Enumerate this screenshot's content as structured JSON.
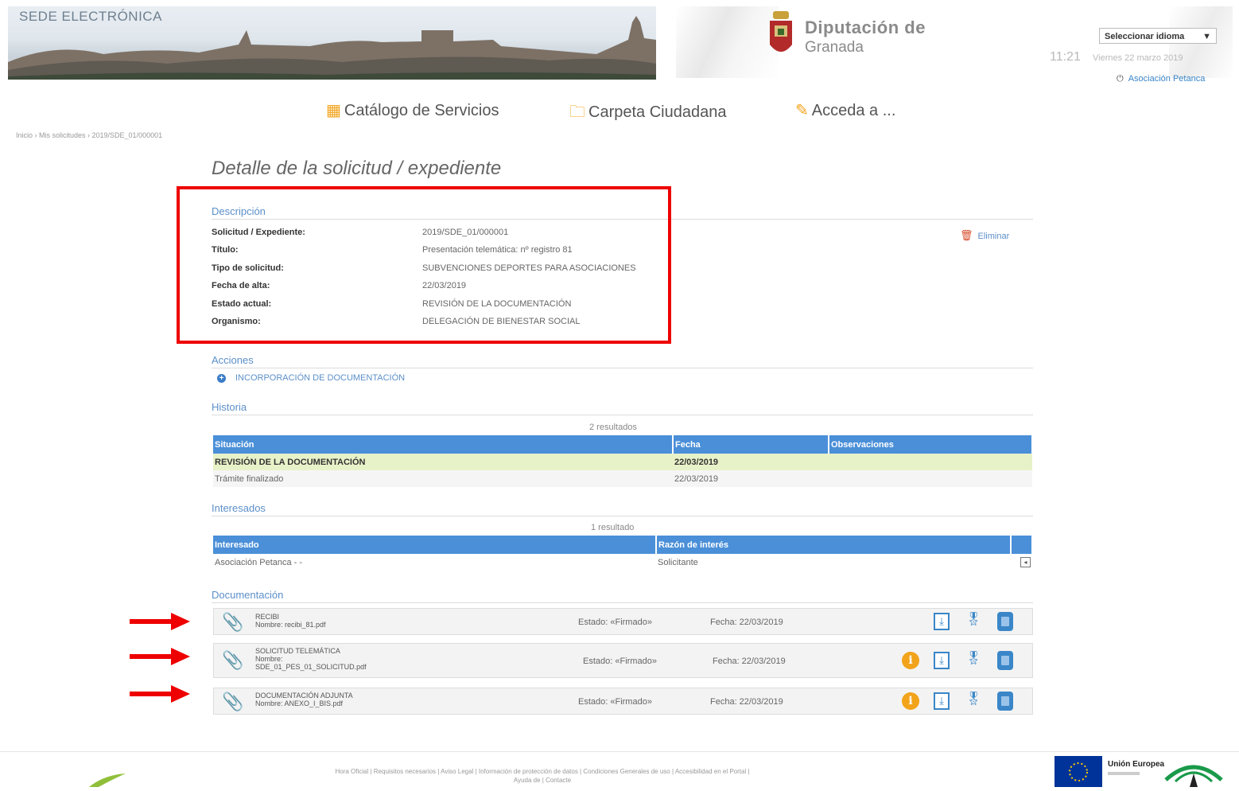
{
  "header": {
    "portal_name": "SEDE ELECTRÓNICA",
    "org_line1": "Diputación de",
    "org_line2": "Granada",
    "language_select": "Seleccionar idioma",
    "time": "11:21",
    "date": "Viernes 22 marzo 2019",
    "user": "Asociación Petanca"
  },
  "nav": [
    {
      "label": "Catálogo de Servicios",
      "icon": "grid-icon"
    },
    {
      "label": "Carpeta Ciudadana",
      "icon": "folder-icon"
    },
    {
      "label": "Acceda a ...",
      "icon": "pencil-icon"
    }
  ],
  "breadcrumb": "Inicio › Mis solicitudes › 2019/SDE_01/000001",
  "page_title": "Detalle de la solicitud / expediente",
  "descripcion": {
    "title": "Descripción",
    "rows": [
      {
        "label": "Solicitud / Expediente:",
        "value": "2019/SDE_01/000001"
      },
      {
        "label": "Título:",
        "value": "Presentación telemática: nº registro 81"
      },
      {
        "label": "Tipo de solicitud:",
        "value": "SUBVENCIONES DEPORTES PARA ASOCIACIONES"
      },
      {
        "label": "Fecha de alta:",
        "value": "22/03/2019"
      },
      {
        "label": "Estado actual:",
        "value": "REVISIÓN DE LA DOCUMENTACIÓN"
      },
      {
        "label": "Organismo:",
        "value": "DELEGACIÓN DE BIENESTAR SOCIAL"
      }
    ],
    "delete_label": "Eliminar"
  },
  "acciones": {
    "title": "Acciones",
    "action_label": "INCORPORACIÓN DE DOCUMENTACIÓN"
  },
  "historia": {
    "title": "Historia",
    "count": "2 resultados",
    "headers": [
      "Situación",
      "Fecha",
      "Observaciones"
    ],
    "rows": [
      [
        "REVISIÓN DE LA DOCUMENTACIÓN",
        "22/03/2019",
        ""
      ],
      [
        "Trámite finalizado",
        "22/03/2019",
        ""
      ]
    ]
  },
  "interesados": {
    "title": "Interesados",
    "count": "1 resultado",
    "headers": [
      "Interesado",
      "Razón de interés",
      ""
    ],
    "rows": [
      [
        "Asociación Petanca - -",
        "Solicitante"
      ]
    ]
  },
  "documentacion": {
    "title": "Documentación",
    "docs": [
      {
        "name": "RECIBI\nNombre: recibi_81.pdf",
        "estado": "Estado: «Firmado»",
        "fecha": "Fecha: 22/03/2019",
        "info": false
      },
      {
        "name": "SOLICITUD TELEMÁTICA\nNombre:\nSDE_01_PES_01_SOLICITUD.pdf",
        "estado": "Estado: «Firmado»",
        "fecha": "Fecha: 22/03/2019",
        "info": true
      },
      {
        "name": "DOCUMENTACIÓN ADJUNTA\nNombre: ANEXO_I_BIS.pdf",
        "estado": "Estado: «Firmado»",
        "fecha": "Fecha: 22/03/2019",
        "info": true
      }
    ]
  },
  "footer": {
    "links_line1": "Hora Oficial | Requisitos necesarios | Aviso Legal | Información de protección de datos | Condiciones Generales de uso | Accesibilidad en el Portal |",
    "links_line2": "Ayuda de | Contacte",
    "eu_label": "Unión Europea"
  },
  "colors": {
    "accent": "#4a8fd8",
    "highlight_row": "#e8f2c8",
    "annotation_red": "#ee0000",
    "clip_orange": "#f2a33a"
  }
}
